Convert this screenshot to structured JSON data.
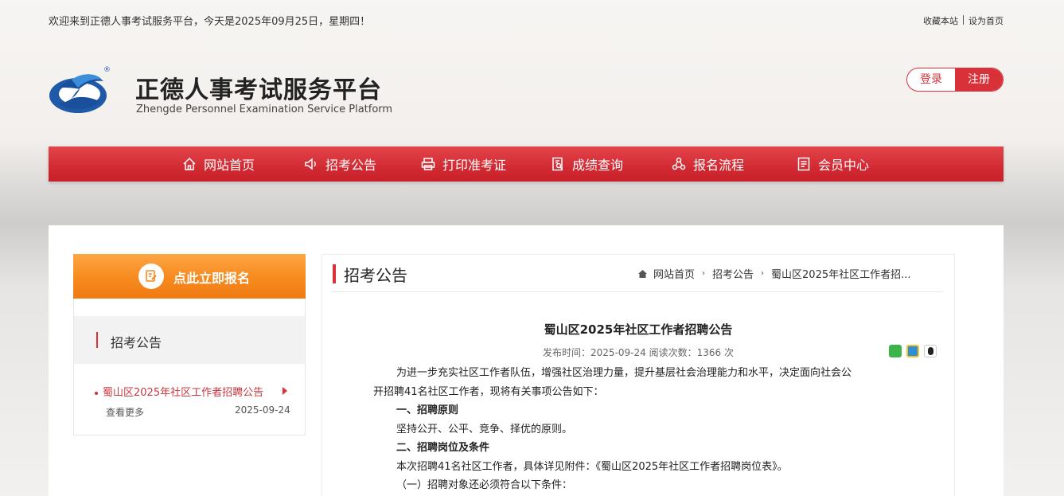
{
  "topbar": {
    "welcome": "欢迎来到正德人事考试服务平台，今天是2025年09月25日，星期四！",
    "favorite": "收藏本站",
    "set_home": "设为首页"
  },
  "header": {
    "title": "正德人事考试服务平台",
    "subtitle": "Zhengde Personnel Examination Service Platform",
    "registered_mark": "®",
    "login": "登录",
    "register": "注册"
  },
  "nav": [
    {
      "label": "网站首页",
      "icon": "home-icon"
    },
    {
      "label": "招考公告",
      "icon": "speaker-icon"
    },
    {
      "label": "打印准考证",
      "icon": "printer-icon"
    },
    {
      "label": "成绩查询",
      "icon": "search-doc-icon"
    },
    {
      "label": "报名流程",
      "icon": "flow-icon"
    },
    {
      "label": "会员中心",
      "icon": "member-icon"
    }
  ],
  "sidebar": {
    "signup_banner": "点此立即报名",
    "section_title": "招考公告",
    "item_title": "蜀山区2025年社区工作者招聘公告",
    "more": "查看更多",
    "item_date": "2025-09-24"
  },
  "content": {
    "section_title": "招考公告",
    "breadcrumb": [
      "网站首页",
      "招考公告",
      "蜀山区2025年社区工作者招..."
    ],
    "article": {
      "title": "蜀山区2025年社区工作者招聘公告",
      "meta": "发布时间：2025-09-24   阅读次数：1366 次",
      "paragraphs": [
        "为进一步充实社区工作者队伍，增强社区治理力量，提升基层社会治理能力和水平，决定面向社会公",
        "开招聘41名社区工作者，现将有关事项公告如下：",
        "一、招聘原则",
        "坚持公开、公平、竞争、择优的原则。",
        "二、招聘岗位及条件",
        "本次招聘41名社区工作者，具体详见附件：《蜀山区2025年社区工作者招聘岗位表》。",
        "（一）招聘对象还必须符合以下条件："
      ]
    }
  },
  "colors": {
    "brand_red": "#d9313a",
    "orange": "#f68a1e"
  }
}
